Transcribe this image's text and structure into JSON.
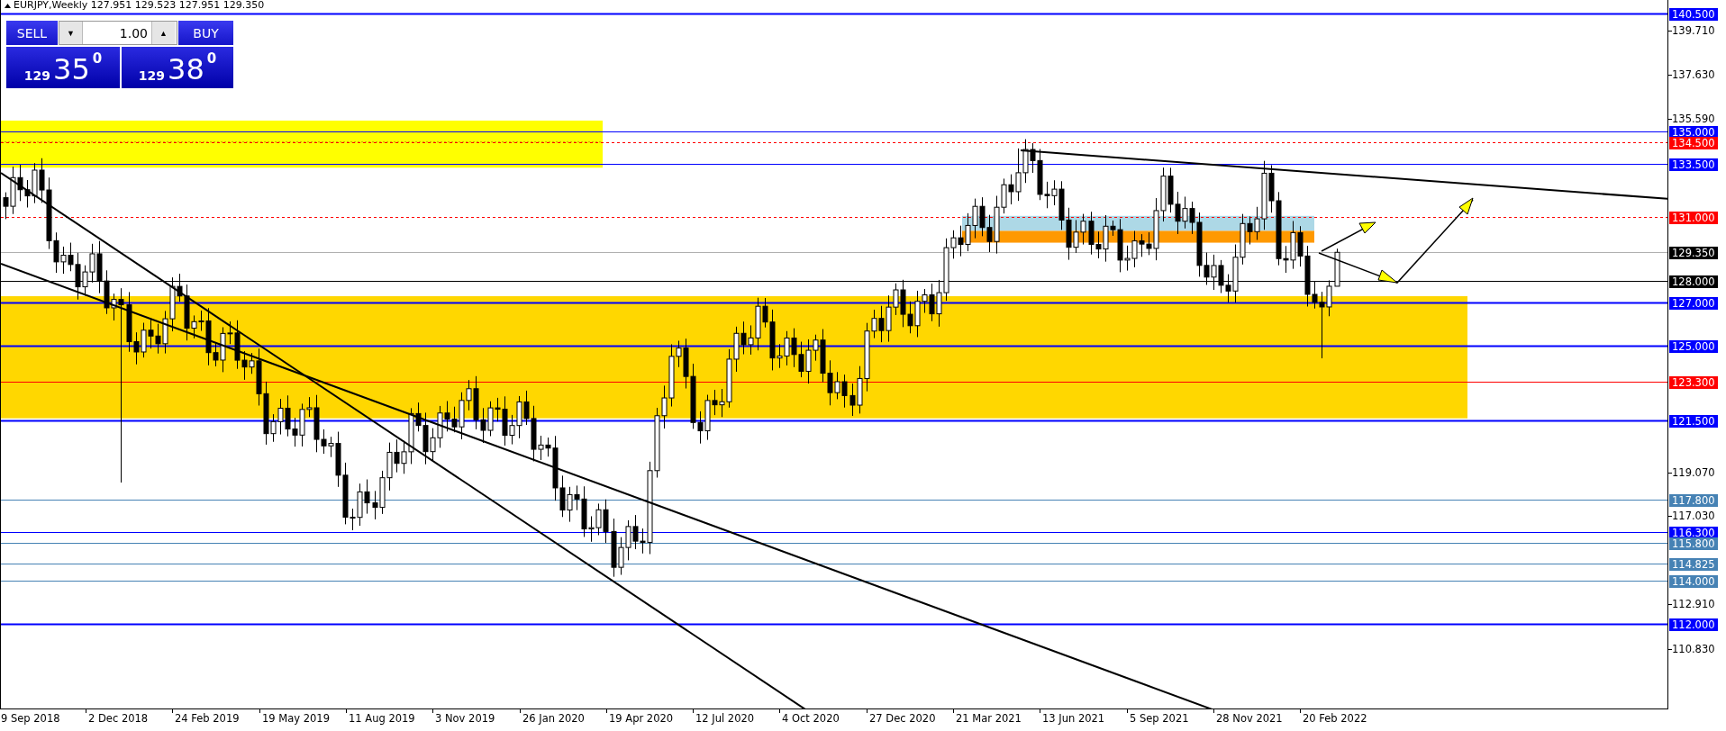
{
  "window": {
    "title": "EURJPY,Weekly  127.951 129.523 127.951 129.350"
  },
  "trade_panel": {
    "sell_label": "SELL",
    "buy_label": "BUY",
    "lot_down": "▼",
    "lot_up": "▲",
    "lot_value": "1.00",
    "sell_price": {
      "big": "129",
      "main": "35",
      "small": "0"
    },
    "buy_price": {
      "big": "129",
      "main": "38",
      "small": "0"
    }
  },
  "price_levels": [
    {
      "label": "140.500",
      "color": "#0000ff",
      "kind": "solid"
    },
    {
      "label": "135.000",
      "color": "#0000ff",
      "kind": "solid"
    },
    {
      "label": "134.500",
      "color": "#ff0000",
      "kind": "dashed"
    },
    {
      "label": "133.500",
      "color": "#0000ff",
      "kind": "solid"
    },
    {
      "label": "131.000",
      "color": "#ff0000",
      "kind": "dashed"
    },
    {
      "label": "129.350",
      "color": "#000000",
      "kind": "solid"
    },
    {
      "label": "128.000",
      "color": "#000000",
      "kind": "solid"
    },
    {
      "label": "127.000",
      "color": "#0000ff",
      "kind": "solid"
    },
    {
      "label": "125.000",
      "color": "#0000ff",
      "kind": "solid"
    },
    {
      "label": "123.300",
      "color": "#ff0000",
      "kind": "solid"
    },
    {
      "label": "121.500",
      "color": "#0000ff",
      "kind": "solid"
    },
    {
      "label": "117.800",
      "color": "#4682b4",
      "kind": "solid"
    },
    {
      "label": "116.300",
      "color": "#0000ff",
      "kind": "solid"
    },
    {
      "label": "115.800",
      "color": "#4682b4",
      "kind": "solid"
    },
    {
      "label": "114.825",
      "color": "#4682b4",
      "kind": "solid"
    },
    {
      "label": "114.000",
      "color": "#4682b4",
      "kind": "solid"
    },
    {
      "label": "112.000",
      "color": "#0000ff",
      "kind": "solid"
    }
  ],
  "price_ticks": [
    "139.710",
    "137.630",
    "135.590",
    "119.070",
    "117.030",
    "112.910",
    "110.830"
  ],
  "date_labels": [
    "9 Sep 2018",
    "2 Dec 2018",
    "24 Feb 2019",
    "19 May 2019",
    "11 Aug 2019",
    "3 Nov 2019",
    "26 Jan 2020",
    "19 Apr 2020",
    "12 Jul 2020",
    "4 Oct 2020",
    "27 Dec 2020",
    "21 Mar 2021",
    "13 Jun 2021",
    "5 Sep 2021",
    "28 Nov 2021",
    "20 Feb 2022"
  ]
}
